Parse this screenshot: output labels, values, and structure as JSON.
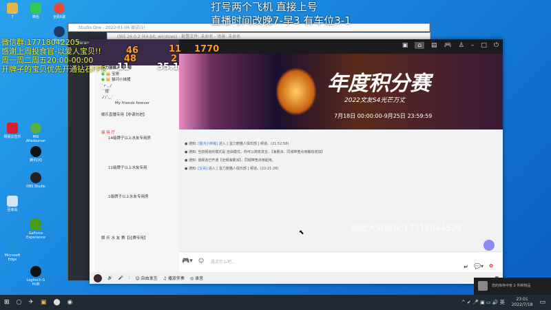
{
  "overlay": {
    "top_lines": [
      "打号两个飞机 直接上号",
      "直播时间改晚7-早3 有车位3-1"
    ],
    "left_lines": [
      "微信群:17718042205",
      "感谢上周投食官-以爱人宝贝!!",
      "周一周二周五20:00-00:00",
      "开牌子的宝贝优先开通钻石FPS"
    ],
    "stats": [
      "46",
      "11",
      "1770",
      "48",
      "2",
      "11",
      "35.1"
    ],
    "watermark": "游戏大神陪玩:17718044520"
  },
  "desktop_icons": [
    "7",
    "微信",
    "全民K歌",
    "Steam",
    "Microsoft Edge",
    "OBS Studio",
    "GeForce Experience",
    "MSI Afterburner",
    "网易云音乐",
    "腾讯QQ",
    "回收站",
    "Logitech G HUB"
  ],
  "windows": {
    "studio_one": "Studio One - 2022-01-06 调试(1)",
    "obs": "OBS 26.0.2 (64-bit, windows) - 配置文件: 未命名 - 场景: 未命名",
    "params": "Params"
  },
  "room": {
    "name": "蛋力丽猫人俱乐部",
    "members": [
      "宝哥",
      "猫河小妹猪"
    ],
    "channels": [
      "`ｒ◡/",
      "`ˋ煜ˋ",
      "ノ/`◡`",
      "My friends forever",
      "娱乐直播专用【非请勿进】",
      "接 待 厅",
      "14级牌子以上水友专用房",
      "11级牌子以上水友专用",
      "1级牌子以上水友专用房",
      "娱 乐 水 友 赛【比赛专用】"
    ]
  },
  "banner": {
    "title": "年度积分赛",
    "subtitle": "2022文友S4光芒万丈",
    "dates": "7月18日 00:00:00-9月25日 23:59:59"
  },
  "messages": [
    {
      "label": "通知:",
      "user": "[猫河小妹猪]",
      "text": " 进入 [ 蛋力丽猫人俱乐部 ] 频道。(21:52:58)"
    },
    {
      "label": "通知:",
      "user": "",
      "text": "当前频道的模式是 自由模式，你可以随意发言。【海量派、同城带宽点用触有增加】"
    },
    {
      "label": "通知:",
      "user": "",
      "text": "该频道已开通【全频海量派】，同城带宽点用起用。"
    },
    {
      "label": "通知:",
      "user": "[宝哥]",
      "text": " 进入 [ 蛋力丽猫人俱乐部 ] 频道。(22:21:26)"
    }
  ],
  "input": {
    "placeholder": "说点什么吧..."
  },
  "toolbar": {
    "free_speak": "自由发言",
    "music": "播放伴奏",
    "record": "录音"
  },
  "notification": {
    "text": "您的库存中有 2 件新物品"
  },
  "clock": {
    "time": "23:01",
    "date": "2022/7/18"
  },
  "tray": {
    "ime": "英"
  }
}
